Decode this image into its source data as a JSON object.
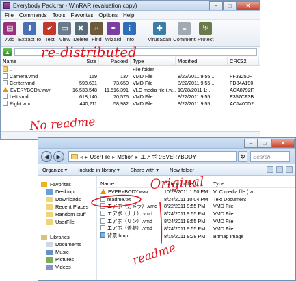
{
  "winrar": {
    "title": "Everybody Pack.rar - WinRAR (evaluation copy)",
    "window_controls": [
      "–",
      "□",
      "✕"
    ],
    "menu": [
      "File",
      "Commands",
      "Tools",
      "Favorites",
      "Options",
      "Help"
    ],
    "toolbar": [
      {
        "label": "Add",
        "icon": "add-archive-icon",
        "color": "#9a2f7e"
      },
      {
        "label": "Extract To",
        "icon": "extract-to-icon",
        "color": "#4b6fb3"
      },
      {
        "label": "Test",
        "icon": "test-icon",
        "color": "#c0392b"
      },
      {
        "label": "View",
        "icon": "view-icon",
        "color": "#6b7b8c"
      },
      {
        "label": "Delete",
        "icon": "delete-icon",
        "color": "#5a6b7a"
      },
      {
        "label": "Find",
        "icon": "find-icon",
        "color": "#6d5a3b"
      },
      {
        "label": "Wizard",
        "icon": "wizard-icon",
        "color": "#7a3fa0"
      },
      {
        "label": "Info",
        "icon": "info-icon",
        "color": "#2f6fb8"
      },
      {
        "label": "VirusScan",
        "icon": "virusscan-icon",
        "color": "#3c7ca8"
      },
      {
        "label": "Comment",
        "icon": "comment-icon",
        "color": "#a3a9b2"
      },
      {
        "label": "Protect",
        "icon": "protect-icon",
        "color": "#6a7a4a"
      }
    ],
    "columns": {
      "name": "Name",
      "size": "Size",
      "packed": "Packed",
      "type": "Type",
      "modified": "Modified",
      "crc": "CRC32"
    },
    "files": [
      {
        "name": "..",
        "size": "",
        "packed": "",
        "type": "File folder",
        "modified": "",
        "crc": "",
        "icon": "folder"
      },
      {
        "name": "Camera.vmd",
        "size": "159",
        "packed": "137",
        "type": "VMD File",
        "modified": "8/22/2011 9:55 ...",
        "crc": "FF33250F",
        "icon": "file"
      },
      {
        "name": "Center.vmd",
        "size": "598,631",
        "packed": "73,650",
        "type": "VMD File",
        "modified": "8/22/2011 9:55 ...",
        "crc": "FD84A190",
        "icon": "file"
      },
      {
        "name": "EVERYBODY.wav",
        "size": "16,533,548",
        "packed": "11,516,391",
        "type": "VLC media file (.w...",
        "modified": "10/28/2011 1:...",
        "crc": "ACA8792F",
        "icon": "vlc"
      },
      {
        "name": "Left.vmd",
        "size": "618,140",
        "packed": "70,576",
        "type": "VMD File",
        "modified": "8/22/2011 9:55 ...",
        "crc": "E357CF3B",
        "icon": "file"
      },
      {
        "name": "Right.vmd",
        "size": "440,211",
        "packed": "58,982",
        "type": "VMD File",
        "modified": "8/22/2011 9:55 ...",
        "crc": "AC1400D2",
        "icon": "file"
      }
    ]
  },
  "explorer": {
    "window_controls": [
      "–",
      "□",
      "✕"
    ],
    "breadcrumb": [
      "«",
      "UserFile",
      "Motion",
      "エアボでEVERYBODY"
    ],
    "search_placeholder": "Search",
    "commands": [
      "Organize ▾",
      "Include in library ▾",
      "Share with ▾",
      "New folder"
    ],
    "nav": {
      "favorites_header": "Favorites",
      "favorites": [
        "Desktop",
        "Downloads",
        "Recent Places",
        "Random stuff",
        "UserFile"
      ],
      "libraries_header": "Libraries",
      "libraries": [
        "Documents",
        "Music",
        "Pictures",
        "Videos"
      ]
    },
    "columns": {
      "name": "Name",
      "modified": "Date modified",
      "type": "Type"
    },
    "files": [
      {
        "name": "EVERYBODY.wav",
        "modified": "10/28/2011 1:50 PM",
        "type": "VLC media file (.w...",
        "icon": "vlc"
      },
      {
        "name": "readme.txt",
        "modified": "8/24/2011 10:04 PM",
        "type": "Text Document",
        "icon": "file"
      },
      {
        "name": "エアボ（カメラ）.vmd",
        "modified": "8/22/2011 9:55 PM",
        "type": "VMD File",
        "icon": "file"
      },
      {
        "name": "エアボ（ナナ）.vmd",
        "modified": "8/24/2011 9:55 PM",
        "type": "VMD File",
        "icon": "file"
      },
      {
        "name": "エアボ（リン）.vmd",
        "modified": "8/24/2011 9:55 PM",
        "type": "VMD File",
        "icon": "file"
      },
      {
        "name": "エアボ（蓋夢）.vmd",
        "modified": "8/24/2011 9:55 PM",
        "type": "VMD File",
        "icon": "file"
      },
      {
        "name": "背景.bmp",
        "modified": "8/15/2011 9:28 PM",
        "type": "Bitmap Image",
        "icon": "image"
      }
    ]
  },
  "annotations": {
    "redistributed": "re-distributed",
    "no_readme": "No readme",
    "original": "Original",
    "readme": "readme",
    "color": "#e0141e"
  }
}
